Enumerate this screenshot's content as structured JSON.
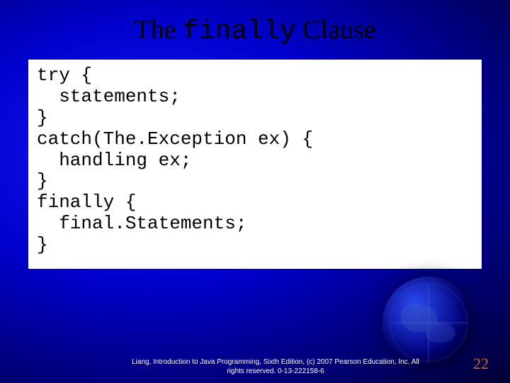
{
  "title": {
    "word1": "The",
    "word2_mono": "finally",
    "word3": "Clause"
  },
  "code": "try {\n  statements;\n}\ncatch(The.Exception ex) {\n  handling ex;\n}\nfinally {\n  final.Statements;\n}",
  "footer": {
    "line1": "Liang, Introduction to Java Programming, Sixth Edition, (c) 2007 Pearson Education, Inc. All",
    "line2": "rights reserved. 0-13-222158-6"
  },
  "page_number": "22"
}
